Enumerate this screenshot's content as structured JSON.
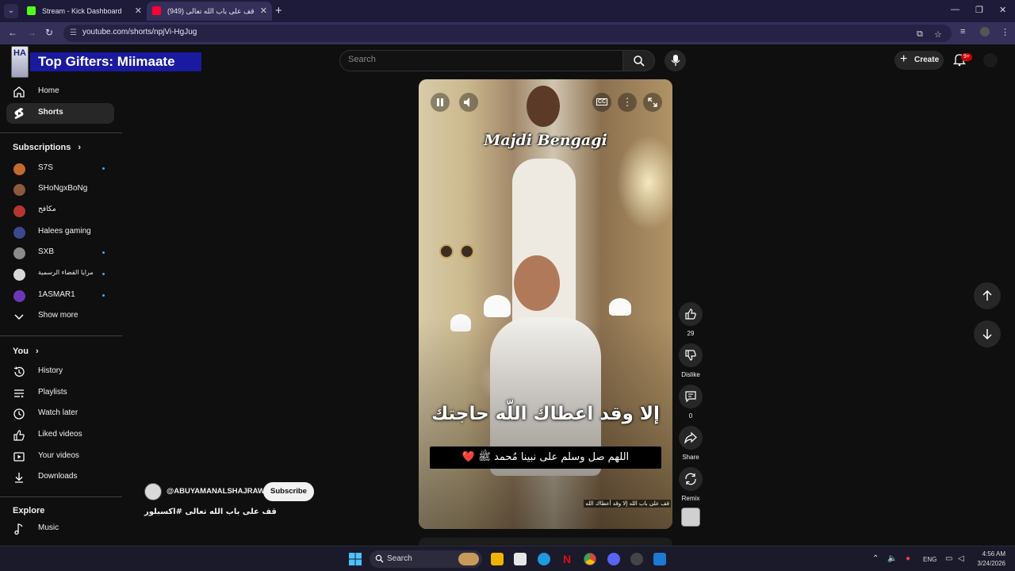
{
  "browser": {
    "tabs": [
      {
        "title": "Stream - Kick Dashboard",
        "favicon_color": "#53fc18"
      },
      {
        "title": "(949) قف على باب الله تعالى",
        "favicon_color": "#ff0033"
      }
    ],
    "url": "youtube.com/shorts/npjVi-HgJug"
  },
  "overlay": {
    "top_gifters": "Top Gifters: Miimaate",
    "logo_letters": "HA"
  },
  "search": {
    "placeholder": "Search"
  },
  "header": {
    "create_label": "Create",
    "notification_count": "9+"
  },
  "sidebar": {
    "main": [
      {
        "label": "Home",
        "icon": "home-icon"
      },
      {
        "label": "Shorts",
        "icon": "shorts-icon"
      }
    ],
    "subscriptions_heading": "Subscriptions",
    "subscriptions": [
      {
        "label": "S7S",
        "color": "#c46a2f",
        "new": true
      },
      {
        "label": "SHoNgxBoNg",
        "color": "#8a5a3a",
        "new": false
      },
      {
        "label": "مكافح",
        "color": "#b4372f",
        "new": false
      },
      {
        "label": "Halees gaming",
        "color": "#3b4a8f",
        "new": false
      },
      {
        "label": "SXB",
        "color": "#8b8b8b",
        "new": true
      },
      {
        "label": "مرايا القضاء الرسمية",
        "color": "#d8d8d8",
        "new": true
      },
      {
        "label": "1ASMAR1",
        "color": "#6d36b8",
        "new": true
      }
    ],
    "show_more": "Show more",
    "you_heading": "You",
    "you": [
      {
        "label": "History",
        "icon": "history-icon"
      },
      {
        "label": "Playlists",
        "icon": "playlists-icon"
      },
      {
        "label": "Watch later",
        "icon": "clock-icon"
      },
      {
        "label": "Liked videos",
        "icon": "thumbs-up-icon"
      },
      {
        "label": "Your videos",
        "icon": "video-icon"
      },
      {
        "label": "Downloads",
        "icon": "download-icon"
      }
    ],
    "explore_heading": "Explore",
    "explore": [
      {
        "label": "Music",
        "icon": "music-icon"
      }
    ]
  },
  "video": {
    "overlay_name": "Majdi Bengagi",
    "caption_main": "إلا وقد اعطاك اللّه حاجتك",
    "caption_box": "اللهم صل وسلم على نبينا مُحمد ﷺ",
    "caption_heart": "❤️",
    "corner_text": "قف على باب الله إلا وقد أعطاك الله",
    "cc_label": "CC"
  },
  "channel": {
    "handle": "@ABUYAMANALSHAJRAWI",
    "subscribe_label": "Subscribe",
    "title": "قف على باب الله تعالى #اكسبلور"
  },
  "actions": {
    "like_count": "29",
    "dislike_label": "Dislike",
    "comment_count": "0",
    "share_label": "Share",
    "remix_label": "Remix"
  },
  "taskbar": {
    "search_label": "Search",
    "language": "ENG",
    "time": "4:56 AM",
    "date": "3/24/2026"
  }
}
